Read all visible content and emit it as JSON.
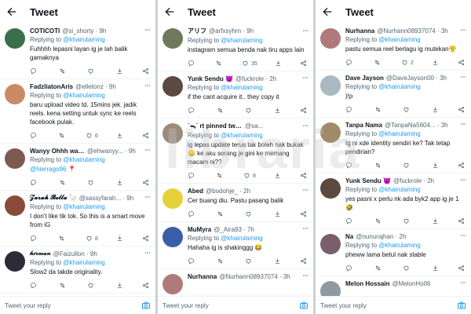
{
  "header_title": "Tweet",
  "compose_placeholder": "Tweet your reply",
  "reply_prefix": "Replying to",
  "watermark": "libraria",
  "panels": [
    {
      "tweets": [
        {
          "name": "COTICOTI",
          "handle": "@si_shorty",
          "time": "9h",
          "mention": "@khairulaming",
          "text": "Fuhhhh lepasni layan ig je lah balik gamaknya",
          "avatar_color": "#3a6f4a",
          "stats": {
            "reply": "",
            "retweet": "",
            "like": ""
          }
        },
        {
          "name": "FadzliatonAris",
          "handle": "@elletonz",
          "time": "9h",
          "mention": "@khairulaming",
          "text": "baru upload video td. 15mins jek. jadik reels. kena setting untuk sync ke reels facebook pulak.",
          "avatar_color": "#c98b66",
          "stats": {
            "reply": "",
            "retweet": "",
            "like": "6"
          }
        },
        {
          "name": "Wanyy Ohhh wany",
          "handle": "@ehwanyy...",
          "time": "9h",
          "mention": "@khairulaming",
          "text": "@hierrago96 📍",
          "avatar_color": "#7d5a4f",
          "stats": {
            "reply": "",
            "retweet": "",
            "like": ""
          }
        },
        {
          "name": "𝓩𝓪𝓻𝓪𝓱 𝓑𝓮𝓵𝓵𝓪 🦙",
          "handle": "@sassyfarah...",
          "time": "9h",
          "mention": "@khairulaming",
          "text": "I don't like tik tok. So this is a smart move from iG",
          "avatar_color": "#8a4b3a",
          "stats": {
            "reply": "",
            "retweet": "",
            "like": "8"
          }
        },
        {
          "name": "𝒽𝒾𝓇𝓂𝒶𝓃",
          "handle": "@Faizullon",
          "time": "9h",
          "mention": "@khairulaming",
          "text": "Slow2 da takde originality.",
          "avatar_color": "#2d2a3a",
          "stats": {
            "reply": "",
            "retweet": "",
            "like": ""
          }
        }
      ]
    },
    {
      "tweets": [
        {
          "name": "アリフ",
          "handle": "@arfxsyhrn",
          "time": "9h",
          "mention": "@khairulaming",
          "text": "instagram semua benda nak tiru apps lain",
          "avatar_color": "#6f7a5d",
          "stats": {
            "reply": "",
            "retweet": "",
            "like": "35"
          }
        },
        {
          "name": "Yunk Sendu 😈",
          "handle": "@fuckrole",
          "time": "2h",
          "mention": "@khairulaming",
          "text": "if the cant acquire it.. they copy it",
          "avatar_color": "#5a4a3f",
          "stats": {
            "reply": "",
            "retweet": "",
            "like": ""
          }
        },
        {
          "name": "`ᯓ´ rt pinned twt pls 😊",
          "handle": "@sa...",
          "time": "",
          "mention": "@khairulaming",
          "text": "ig lepas update terus tak boleh nak bukak 😞 ke aku sorang je gini ke memang macam ni??",
          "avatar_color": "#9a8b7a",
          "stats": {
            "reply": "",
            "retweet": "",
            "like": "8"
          }
        },
        {
          "name": "Abed",
          "handle": "@bodohje_",
          "time": "2h",
          "mention": "",
          "text": "Cer buang diu. Pastu pasang balik",
          "avatar_color": "#e5d23a",
          "stats": {
            "reply": "",
            "retweet": "",
            "like": ""
          }
        },
        {
          "name": "MuMyra",
          "handle": "@_Aira93",
          "time": "7h",
          "mention": "@khairulaming",
          "text": "Hahaha ig is shakinggg 😂",
          "avatar_color": "#3b5ea8",
          "stats": {
            "reply": "",
            "retweet": "",
            "like": ""
          }
        },
        {
          "name": "Nurhanna",
          "handle": "@Nurhann08937074",
          "time": "3h",
          "mention": "",
          "text": "",
          "avatar_color": "#b07a7a",
          "stats": {
            "reply": "",
            "retweet": "",
            "like": ""
          }
        }
      ]
    },
    {
      "tweets": [
        {
          "name": "Nurhanna",
          "handle": "@Nurhann08937074",
          "time": "3h",
          "mention": "@khairulaming",
          "text": "pastu semua reel berlagu ig mutekan😤",
          "avatar_color": "#b07a7a",
          "stats": {
            "reply": "",
            "retweet": "",
            "like": "2"
          }
        },
        {
          "name": "Dave Jayson",
          "handle": "@DaveJayson00",
          "time": "3h",
          "mention": "@khairulaming",
          "text": ")!p",
          "avatar_color": "#aab8c2",
          "stats": {
            "reply": "",
            "retweet": "",
            "like": ""
          }
        },
        {
          "name": "Tanpa Nama",
          "handle": "@TanpaNa5604...",
          "time": "3h",
          "mention": "@khairulaming",
          "text": "Ig ni xde identity sendiri ke? Tak tetap pendirian?",
          "avatar_color": "#a38a66",
          "stats": {
            "reply": "",
            "retweet": "",
            "like": ""
          }
        },
        {
          "name": "Yunk Sendu 😈",
          "handle": "@fuckrole",
          "time": "2h",
          "mention": "@khairulaming",
          "text": "yes pasni x perlu nk ada byk2 app ig je 1 🤣",
          "avatar_color": "#5a4a3f",
          "stats": {
            "reply": "",
            "retweet": "",
            "like": ""
          }
        },
        {
          "name": "Na",
          "handle": "@nunurajhan",
          "time": "2h",
          "mention": "@khairulaming",
          "text": "pheww lama betul nak stable",
          "avatar_color": "#7a5f6b",
          "stats": {
            "reply": "",
            "retweet": "",
            "like": ""
          }
        },
        {
          "name": "Melon Hossain",
          "handle": "@MelonHo06",
          "time": "",
          "mention": "",
          "text": "",
          "avatar_color": "#8c9aa3",
          "stats": {
            "reply": "",
            "retweet": "",
            "like": ""
          }
        }
      ]
    }
  ]
}
